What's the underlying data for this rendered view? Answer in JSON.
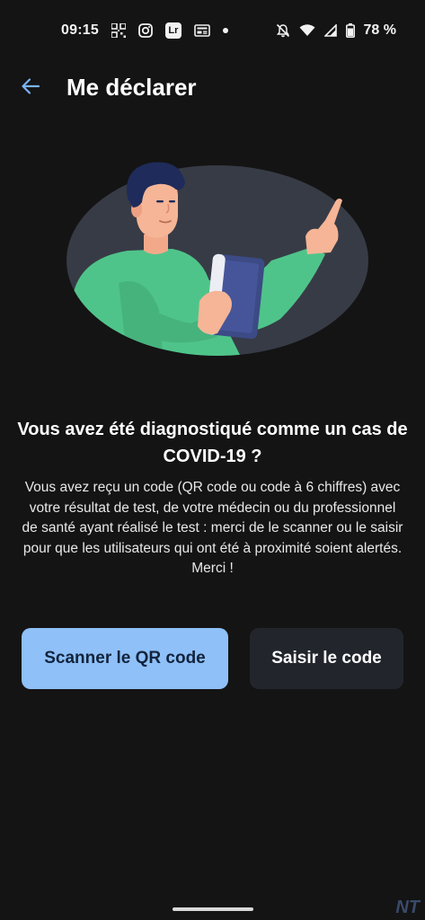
{
  "status_bar": {
    "time": "09:15",
    "lr_label": "Lr",
    "battery": "78 %",
    "icons": [
      "qr-code-icon",
      "instagram-icon",
      "lightroom-icon",
      "news-icon",
      "notification-dot-icon",
      "do-not-disturb-icon",
      "wifi-icon",
      "signal-icon",
      "battery-icon"
    ]
  },
  "app_bar": {
    "title": "Me déclarer",
    "back_icon": "back-arrow-icon"
  },
  "content": {
    "heading": "Vous avez été diagnostiqué comme un cas de COVID-19 ?",
    "body": "Vous avez reçu un code (QR code ou code à 6 chiffres) avec votre résultat de test, de votre médecin ou du professionnel de santé ayant réalisé le test : merci de le scanner ou le saisir pour que les utilisateurs qui ont été à proximité soient alertés. Merci !"
  },
  "buttons": {
    "scan_label": "Scanner le QR code",
    "enter_label": "Saisir le code"
  },
  "watermark": "NT",
  "colors": {
    "background": "#141414",
    "primary_button": "#8fc0f8",
    "primary_button_text": "#12243d",
    "secondary_button": "#22262c",
    "accent": "#7ab3f5",
    "illustration_bg": "#373b46",
    "shirt": "#4fc48a",
    "tablet": "#3c4a86"
  }
}
